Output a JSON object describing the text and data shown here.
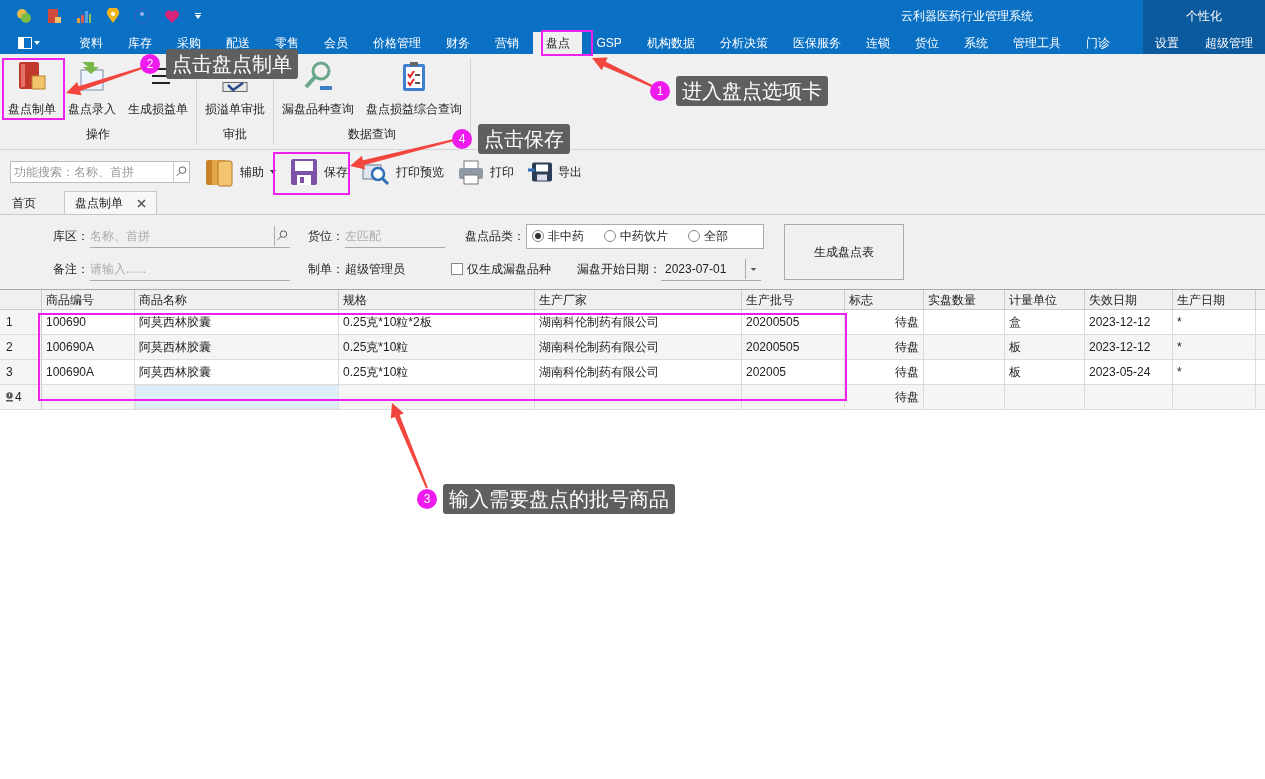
{
  "app_title": "云利器医药行业管理系统",
  "personalize": "个性化",
  "menu_tabs": [
    {
      "label": "资料",
      "selected": false
    },
    {
      "label": "库存",
      "selected": false
    },
    {
      "label": "采购",
      "selected": false
    },
    {
      "label": "配送",
      "selected": false
    },
    {
      "label": "零售",
      "selected": false
    },
    {
      "label": "会员",
      "selected": false
    },
    {
      "label": "价格管理",
      "selected": false
    },
    {
      "label": "财务",
      "selected": false
    },
    {
      "label": "营销",
      "selected": false
    },
    {
      "label": "盘点",
      "selected": true
    },
    {
      "label": "GSP",
      "selected": false
    },
    {
      "label": "机构数据",
      "selected": false
    },
    {
      "label": "分析决策",
      "selected": false
    },
    {
      "label": "医保服务",
      "selected": false
    },
    {
      "label": "连锁",
      "selected": false
    },
    {
      "label": "货位",
      "selected": false
    },
    {
      "label": "系统",
      "selected": false
    },
    {
      "label": "管理工具",
      "selected": false
    },
    {
      "label": "门诊",
      "selected": false
    }
  ],
  "right_tabs": [
    "设置",
    "超级管理"
  ],
  "ribbon_groups": [
    {
      "label": "操作",
      "buttons": [
        {
          "label": "盘点制单",
          "kind": "box"
        },
        {
          "label": "盘点录入",
          "kind": "entry"
        },
        {
          "label": "生成损益单",
          "kind": "list"
        }
      ]
    },
    {
      "label": "审批",
      "buttons": [
        {
          "label": "损溢单审批",
          "kind": "check"
        }
      ]
    },
    {
      "label": "数据查询",
      "buttons": [
        {
          "label": "漏盘品种查询",
          "kind": "magnifier"
        },
        {
          "label": "盘点损益综合查询",
          "kind": "clipboard"
        }
      ]
    }
  ],
  "toolbar": {
    "search_placeholder": "功能搜索：名称、首拼",
    "buttons": [
      {
        "label": "辅助",
        "kind": "books"
      },
      {
        "label": "保存",
        "kind": "save"
      },
      {
        "label": "打印预览",
        "kind": "preview"
      },
      {
        "label": "打印",
        "kind": "print"
      },
      {
        "label": "导出",
        "kind": "export"
      }
    ]
  },
  "doc_tabs": [
    {
      "label": "首页",
      "selected": false
    },
    {
      "label": "盘点制单",
      "selected": true
    }
  ],
  "form": {
    "warehouse_label": "库区：",
    "warehouse_placeholder": "名称、首拼",
    "location_label": "货位：",
    "location_placeholder": "左匹配",
    "category_label": "盘点品类：",
    "category_options": [
      {
        "label": "非中药",
        "selected": true
      },
      {
        "label": "中药饮片",
        "selected": false
      },
      {
        "label": "全部",
        "selected": false
      }
    ],
    "note_label": "备注：",
    "note_placeholder": "请输入......",
    "maker_label": "制单：",
    "maker": "超级管理员",
    "only_missing": {
      "label": "仅生成漏盘品种",
      "checked": false
    },
    "start_date_label": "漏盘开始日期：",
    "start_date": "2023-07-01",
    "generate_button": "生成盘点表"
  },
  "table": {
    "columns": [
      "商品编号",
      "商品名称",
      "规格",
      "生产厂家",
      "生产批号",
      "标志",
      "实盘数量",
      "计量单位",
      "失效日期",
      "生产日期"
    ],
    "rows": [
      {
        "number": "1",
        "editing": false,
        "product_code": "100690",
        "product_name": "阿莫西林胶囊",
        "spec": "0.25克*10粒*2板",
        "manufacturer": "湖南科伦制药有限公司",
        "batch_no": "20200505",
        "flag": "待盘",
        "unit": "盒",
        "expiry_date": "2023-12-12",
        "production_date": "*"
      },
      {
        "number": "2",
        "editing": false,
        "product_code": "100690A",
        "product_name": "阿莫西林胶囊",
        "spec": "0.25克*10粒",
        "manufacturer": "湖南科伦制药有限公司",
        "batch_no": "20200505",
        "flag": "待盘",
        "unit": "板",
        "expiry_date": "2023-12-12",
        "production_date": "*"
      },
      {
        "number": "3",
        "editing": false,
        "product_code": "100690A",
        "product_name": "阿莫西林胶囊",
        "spec": "0.25克*10粒",
        "manufacturer": "湖南科伦制药有限公司",
        "batch_no": "202005",
        "flag": "待盘",
        "unit": "板",
        "expiry_date": "2023-05-24",
        "production_date": "*"
      },
      {
        "number": "4",
        "editing": true,
        "flag": "待盘"
      }
    ]
  },
  "annotations": [
    {
      "number": "2",
      "text": "点击盘点制单"
    },
    {
      "number": "1",
      "text": "进入盘点选项卡"
    },
    {
      "number": "4",
      "text": "点击保存"
    },
    {
      "number": "3",
      "text": "输入需要盘点的批号商品"
    }
  ]
}
